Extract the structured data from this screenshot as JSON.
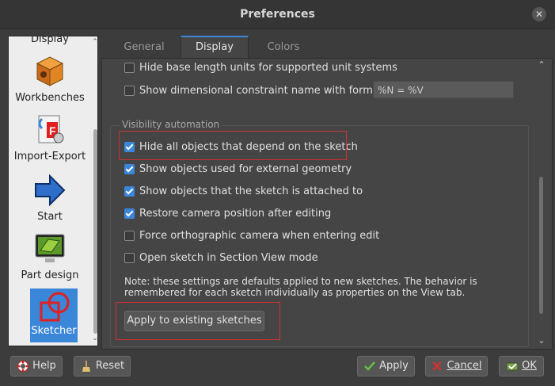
{
  "window": {
    "title": "Preferences",
    "close_glyph": "✕"
  },
  "sidebar": {
    "items": [
      {
        "label": "Display",
        "icon": "display-icon"
      },
      {
        "label": "Workbenches",
        "icon": "workbenches-icon"
      },
      {
        "label": "Import-Export",
        "icon": "import-export-icon"
      },
      {
        "label": "Start",
        "icon": "start-arrow-icon"
      },
      {
        "label": "Part design",
        "icon": "part-design-icon"
      },
      {
        "label": "Sketcher",
        "icon": "sketcher-icon",
        "selected": true
      }
    ]
  },
  "tabs": [
    {
      "label": "General",
      "active": false
    },
    {
      "label": "Display",
      "active": true
    },
    {
      "label": "Colors",
      "active": false
    }
  ],
  "options_top": [
    {
      "label": "Hide base length units for supported unit systems",
      "checked": false
    },
    {
      "label": "Show dimensional constraint name with format",
      "checked": false
    }
  ],
  "format_input": {
    "value": "%N = %V"
  },
  "visibility": {
    "title": "Visibility automation",
    "options": [
      {
        "label": "Hide all objects that depend on the sketch",
        "checked": true
      },
      {
        "label": "Show objects used for external geometry",
        "checked": true
      },
      {
        "label": "Show objects that the sketch is attached to",
        "checked": true
      },
      {
        "label": "Restore camera position after editing",
        "checked": true
      },
      {
        "label": "Force orthographic camera when entering edit",
        "checked": false
      },
      {
        "label": "Open sketch in Section View mode",
        "checked": false
      }
    ],
    "note_line1": "Note: these settings are defaults applied to new sketches. The behavior is",
    "note_line2": "remembered for each sketch individually as properties on the View tab.",
    "apply_button": "Apply to existing sketches"
  },
  "footer": {
    "help": "Help",
    "reset": "Reset",
    "apply": "Apply",
    "cancel": "Cancel",
    "ok": "OK"
  },
  "colors": {
    "accent": "#3a86d9",
    "highlight": "#d03030"
  }
}
